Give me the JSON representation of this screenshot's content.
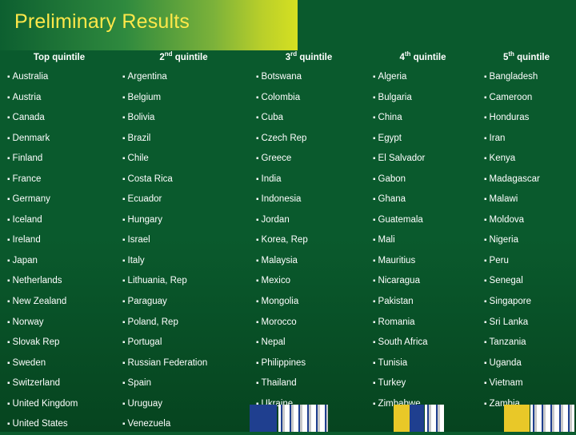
{
  "slide": {
    "title": "Preliminary Results",
    "title_color": "#ffe84a"
  },
  "table": {
    "headers": [
      {
        "main": "Top quintile",
        "sup": ""
      },
      {
        "main": "2",
        "sup": "nd",
        "tail": " quintile"
      },
      {
        "main": "3",
        "sup": "rd",
        "tail": " quintile"
      },
      {
        "main": "4",
        "sup": "th",
        "tail": " quintile"
      },
      {
        "main": "5",
        "sup": "th",
        "tail": " quintile"
      }
    ],
    "header_labels": [
      "Top quintile",
      "2nd quintile",
      "3rd quintile",
      "4th quintile",
      "5th quintile"
    ],
    "columns": [
      [
        "Australia",
        "Austria",
        "Canada",
        "Denmark",
        "Finland",
        "France",
        "Germany",
        "Iceland",
        "Ireland",
        "Japan",
        "Netherlands",
        "New Zealand",
        "Norway",
        "Slovak Rep",
        "Sweden",
        "Switzerland",
        "United Kingdom",
        "United States"
      ],
      [
        "Argentina",
        "Belgium",
        "Bolivia",
        "Brazil",
        "Chile",
        "Costa Rica",
        "Ecuador",
        "Hungary",
        "Israel",
        "Italy",
        "Lithuania, Rep",
        "Paraguay",
        "Poland, Rep",
        "Portugal",
        "Russian Federation",
        "Spain",
        "Uruguay",
        "Venezuela"
      ],
      [
        "Botswana",
        "Colombia",
        "Cuba",
        "Czech Rep",
        "Greece",
        "India",
        "Indonesia",
        "Jordan",
        "Korea, Rep",
        "Malaysia",
        "Mexico",
        "Mongolia",
        "Morocco",
        "Nepal",
        "Philippines",
        "Thailand",
        "Ukraine"
      ],
      [
        "Algeria",
        "Bulgaria",
        "China",
        "Egypt",
        "El Salvador",
        "Gabon",
        "Ghana",
        "Guatemala",
        "Mali",
        "Mauritius",
        "Nicaragua",
        "Pakistan",
        "Romania",
        "South Africa",
        "Tunisia",
        "Turkey",
        "Zimbabwe"
      ],
      [
        "Bangladesh",
        "Cameroon",
        "Honduras",
        "Iran",
        "Kenya",
        "Madagascar",
        "Malawi",
        "Moldova",
        "Nigeria",
        "Peru",
        "Senegal",
        "Singapore",
        "Sri Lanka",
        "Tanzania",
        "Uganda",
        "Vietnam",
        "Zambia"
      ]
    ]
  },
  "bullet": "▪"
}
